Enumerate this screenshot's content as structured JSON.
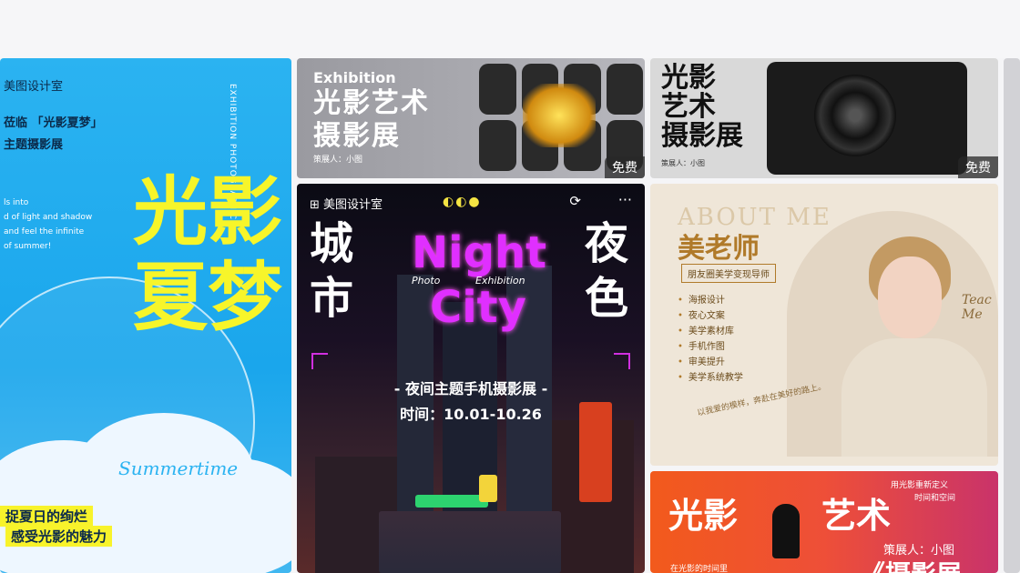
{
  "cards": {
    "summer": {
      "studio": "美图设计室",
      "intro": "光影夏梦",
      "intro_prefix": "莅临",
      "subtitle": "主题摄影展",
      "vertical_text": "EXHIBITION PHOTOGRAPHIC",
      "tiny_lines": [
        "ls into",
        "d of light and shadow",
        "and feel the infinite",
        "of summer!"
      ],
      "big_title_1": "光影",
      "big_title_2": "夏梦",
      "script": "Summertime",
      "line1": "捉夏日的绚烂",
      "line2": "感受光影的魅力"
    },
    "exhibition": {
      "english": "Exhibition",
      "title_1": "光影艺术",
      "title_2": "摄影展",
      "curator": "策展人：小图",
      "badge": "免费"
    },
    "camera": {
      "title_1": "光影",
      "title_2": "艺术",
      "title_3": "摄影展",
      "curator": "策展人：小图",
      "badge": "免费"
    },
    "night_city": {
      "header": "美图设计室",
      "left_1": "城",
      "left_2": "市",
      "right_1": "夜",
      "right_2": "色",
      "night": "Night",
      "city": "City",
      "script_1": "Photo",
      "script_2": "Exhibition",
      "subtitle": "- 夜间主题手机摄影展 -",
      "time": "时间：10.01-10.26"
    },
    "teacher": {
      "about": "ABOUT ME",
      "name": "美老师",
      "tag": "朋友圈美学变现导师",
      "items": [
        "海报设计",
        "夜心文案",
        "美学素材库",
        "手机作图",
        "审美提升",
        "美学系统教学"
      ],
      "rotated": "以我爱的模样，奔赴在美好的路上。",
      "script": "Teac Me"
    },
    "orange": {
      "title_1": "光影",
      "title_2": "艺术",
      "top_text": "用光影重新定义",
      "top_text_2": "时间和空间",
      "curator": "策展人：小图",
      "bottom_title": "《摄影展",
      "bottom_left": "在光影的时间里"
    }
  }
}
